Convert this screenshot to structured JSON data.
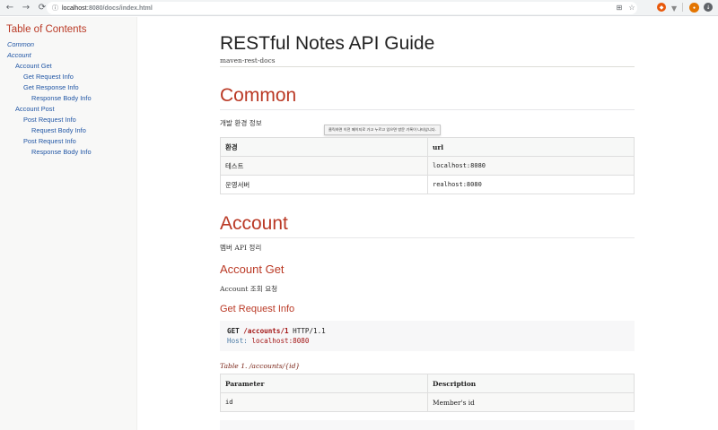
{
  "browser": {
    "url_host": "localhost",
    "url_path": ":8080/docs/index.html"
  },
  "toc": {
    "title": "Table of Contents",
    "items": [
      {
        "label": "Common",
        "level": 1
      },
      {
        "label": "Account",
        "level": 1
      },
      {
        "label": "Account Get",
        "level": 2
      },
      {
        "label": "Get Request Info",
        "level": 3
      },
      {
        "label": "Get Response Info",
        "level": 3
      },
      {
        "label": "Response Body Info",
        "level": 4
      },
      {
        "label": "Account Post",
        "level": 2
      },
      {
        "label": "Post Request Info",
        "level": 3
      },
      {
        "label": "Request Body Info",
        "level": 4
      },
      {
        "label": "Post Request Info",
        "level": 3
      },
      {
        "label": "Response Body Info",
        "level": 4
      }
    ]
  },
  "doc": {
    "title": "RESTful Notes API Guide",
    "subtitle": "maven-rest-docs"
  },
  "common": {
    "heading": "Common",
    "intro": "개발 환경 정보",
    "tooltip": "클릭하면 이전 페이지로 가고 누르고 있으면 방문 기록이 나타납니다.",
    "table": {
      "headers": [
        "환경",
        "url"
      ],
      "rows": [
        [
          "테스트",
          "localhost:8080"
        ],
        [
          "운영서버",
          "realhost:8080"
        ]
      ]
    }
  },
  "account": {
    "heading": "Account",
    "intro": "멤버 API 정리",
    "get_heading": "Account Get",
    "get_intro": "Account 조회 요청",
    "request_heading": "Get Request Info",
    "request": {
      "method": "GET",
      "path": "/accounts/1",
      "protocol": "HTTP/1.1",
      "header_name": "Host:",
      "header_value": "localhost:8080"
    },
    "table_caption": "Table 1. /accounts/{id}",
    "param_table": {
      "headers": [
        "Parameter",
        "Description"
      ],
      "rows": [
        [
          "id",
          "Member's id"
        ]
      ]
    }
  },
  "colors": {
    "accent": "#ba3925",
    "link": "#2156a5",
    "sidebar_bg": "#f8f8f7"
  }
}
